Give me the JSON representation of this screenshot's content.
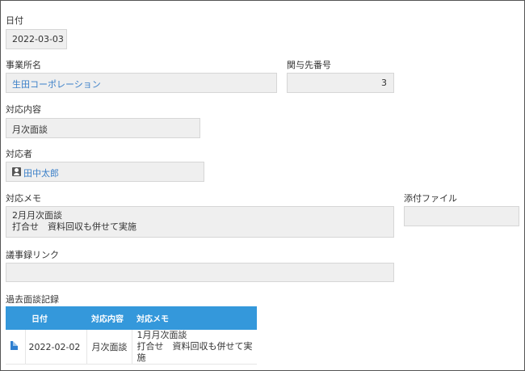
{
  "fields": {
    "date": {
      "label": "日付",
      "value": "2022-03-03"
    },
    "office_name": {
      "label": "事業所名",
      "value": "生田コーポレーション"
    },
    "related_number": {
      "label": "関与先番号",
      "value": "3"
    },
    "response_content": {
      "label": "対応内容",
      "value": "月次面談"
    },
    "responder": {
      "label": "対応者",
      "value": "田中太郎"
    },
    "response_memo": {
      "label": "対応メモ",
      "lines": [
        "2月月次面談",
        "打合せ　資料回収も併せて実施"
      ]
    },
    "attachment": {
      "label": "添付ファイル",
      "value": ""
    },
    "minutes_link": {
      "label": "議事録リンク",
      "value": ""
    }
  },
  "past_records": {
    "label": "過去面談記録",
    "columns": [
      "",
      "日付",
      "対応内容",
      "対応メモ"
    ],
    "rows": [
      {
        "icon": "document-icon",
        "date": "2022-02-02",
        "content": "月次面談",
        "memo_lines": [
          "1月月次面談",
          "打合せ　資料回収も併せて実施"
        ]
      }
    ]
  },
  "colors": {
    "accent": "#3498db",
    "link": "#3a7fc8",
    "field_bg": "#efefef"
  }
}
